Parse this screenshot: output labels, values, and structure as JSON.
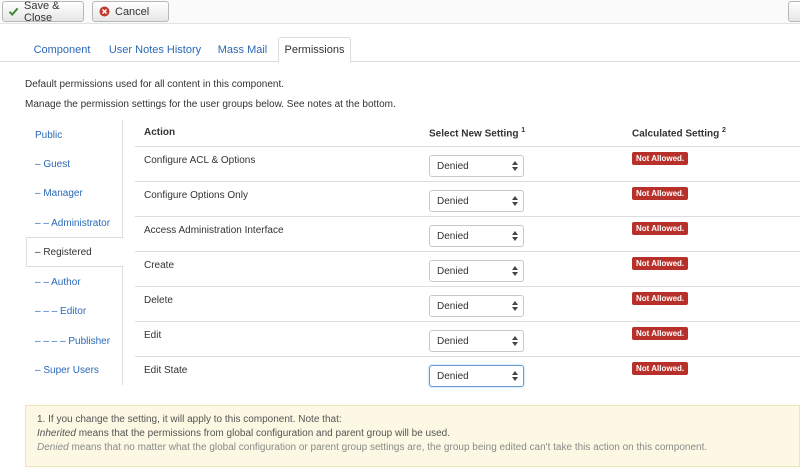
{
  "toolbar": {
    "save_close_label": "Save & Close",
    "cancel_label": "Cancel"
  },
  "tabs": [
    {
      "label": "Component"
    },
    {
      "label": "User Notes History"
    },
    {
      "label": "Mass Mail"
    },
    {
      "label": "Permissions",
      "active": true
    }
  ],
  "intro": {
    "line1": "Default permissions used for all content in this component.",
    "line2": "Manage the permission settings for the user groups below. See notes at the bottom."
  },
  "groups": [
    {
      "label": "Public"
    },
    {
      "label": "– Guest"
    },
    {
      "label": "– Manager"
    },
    {
      "label": "– – Administrator"
    },
    {
      "label": "– Registered",
      "active": true
    },
    {
      "label": "– – Author"
    },
    {
      "label": "– – – Editor"
    },
    {
      "label": "– – – – Publisher"
    },
    {
      "label": "– Super Users"
    }
  ],
  "table": {
    "col_action": "Action",
    "col_setting": "Select New Setting",
    "col_setting_note": "1",
    "col_calculated": "Calculated Setting",
    "col_calculated_note": "2",
    "rows": [
      {
        "action": "Configure ACL & Options",
        "setting": "Denied",
        "calculated": "Not Allowed."
      },
      {
        "action": "Configure Options Only",
        "setting": "Denied",
        "calculated": "Not Allowed."
      },
      {
        "action": "Access Administration Interface",
        "setting": "Denied",
        "calculated": "Not Allowed."
      },
      {
        "action": "Create",
        "setting": "Denied",
        "calculated": "Not Allowed."
      },
      {
        "action": "Delete",
        "setting": "Denied",
        "calculated": "Not Allowed."
      },
      {
        "action": "Edit",
        "setting": "Denied",
        "calculated": "Not Allowed."
      },
      {
        "action": "Edit State",
        "setting": "Denied",
        "calculated": "Not Allowed."
      }
    ]
  },
  "notes": {
    "line1": "1. If you change the setting, it will apply to this component. Note that:",
    "line2_em": "Inherited",
    "line2_rest": " means that the permissions from global configuration and parent group will be used.",
    "line3_em": "Denied",
    "line3_rest": " means that no matter what the global configuration or parent group settings are, the group being edited can't take this action on this component."
  },
  "colors": {
    "link": "#2a69b8",
    "badge_danger": "#b7312a",
    "save_icon": "#3a8a2e",
    "cancel_icon": "#c0392b",
    "notes_bg": "#fcf8e3"
  },
  "icons": {
    "save": "checkmark-icon",
    "cancel": "cancel-circle-icon",
    "select_arrow": "updown-arrow-icon"
  }
}
